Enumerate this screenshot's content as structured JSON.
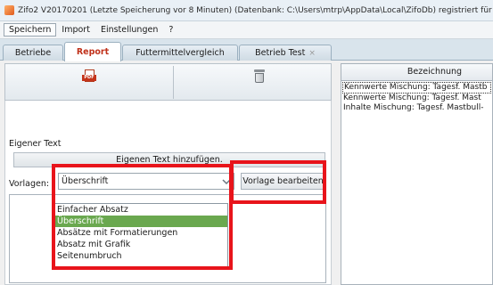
{
  "window": {
    "title": "Zifo2 V20170201 (Letzte Speicherung vor 8 Minuten) (Datenbank: C:\\Users\\mtrp\\AppData\\Local\\ZifoDb) registriert für Zifo",
    "icon": "app-icon"
  },
  "menu": {
    "items": [
      "Speichern",
      "Import",
      "Einstellungen",
      "?"
    ]
  },
  "tabs": [
    {
      "label": "Betriebe"
    },
    {
      "label": "Report",
      "active": true
    },
    {
      "label": "Futtermittelvergleich"
    },
    {
      "label": "Betrieb Test",
      "closable": true
    }
  ],
  "toolbar": {
    "pdf_icon": "pdf-icon",
    "delete_icon": "trash-icon"
  },
  "own_text": {
    "section_label": "Eigener Text",
    "add_button": "Eigenen Text hinzufügen."
  },
  "templates": {
    "label": "Vorlagen:",
    "selected": "Überschrift",
    "edit_button": "Vorlage bearbeiten",
    "options": [
      "Einfacher Absatz",
      "Überschrift",
      "Absätze mit Formatierungen",
      "Absatz mit Grafik",
      "Seitenumbruch"
    ],
    "selected_index": 1
  },
  "right_list": {
    "header": "Bezeichnung",
    "rows": [
      "Kennwerte Mischung: Tagesf. Mastb",
      "Kennwerte Mischung: Tagesf. Mast",
      "Inhalte Mischung: Tagesf. Mastbull-"
    ]
  },
  "colors": {
    "highlight": "#e8141b",
    "selected_item": "#6aa84f",
    "active_tab_text": "#c0311a"
  }
}
